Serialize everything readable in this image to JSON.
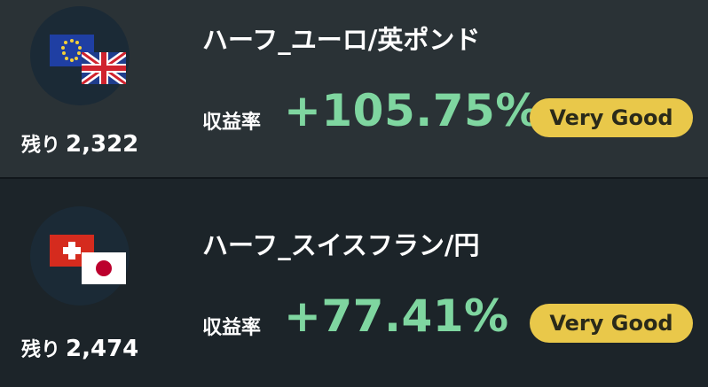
{
  "rows": [
    {
      "pair_name": "ハーフ_ユーロ/英ポンド",
      "remaining_label": "残り",
      "remaining_value": "2,322",
      "rate_label": "収益率",
      "rate_value": "+105.75%",
      "rating": "Very Good",
      "flags": [
        "eu-flag-icon",
        "uk-flag-icon"
      ]
    },
    {
      "pair_name": "ハーフ_スイスフラン/円",
      "remaining_label": "残り",
      "remaining_value": "2,474",
      "rate_label": "収益率",
      "rate_value": "+77.41%",
      "rating": "Very Good",
      "flags": [
        "swiss-flag-icon",
        "japan-flag-icon"
      ]
    }
  ],
  "colors": {
    "rate_green": "#7fd6a0",
    "badge_yellow": "#e9c84a",
    "card_top": "#2a3236",
    "card_bottom": "#1c2429"
  }
}
